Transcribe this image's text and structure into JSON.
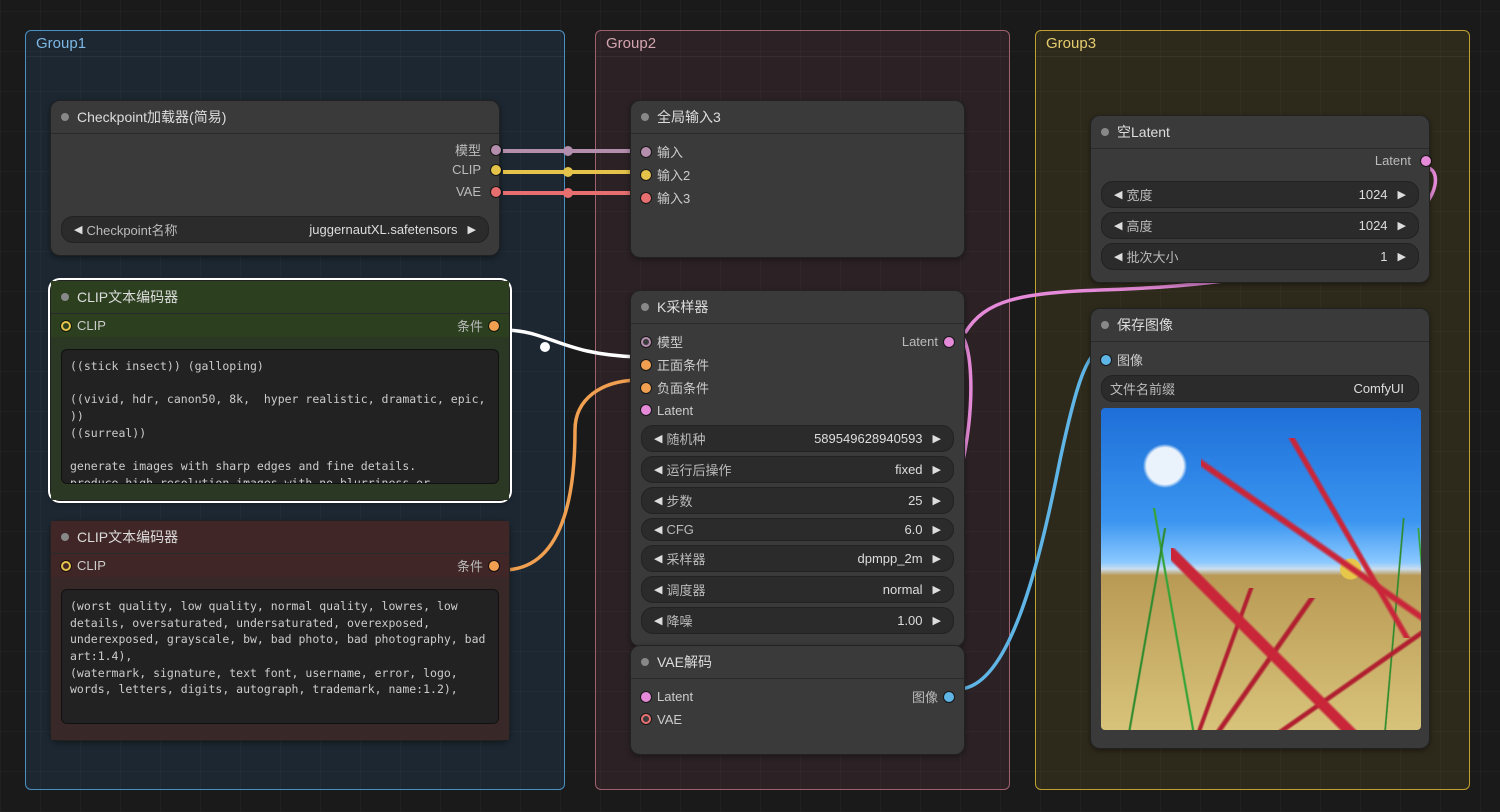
{
  "groups": {
    "g1": "Group1",
    "g2": "Group2",
    "g3": "Group3"
  },
  "checkpoint_loader": {
    "title": "Checkpoint加载器(简易)",
    "outputs": {
      "model": "模型",
      "clip": "CLIP",
      "vae": "VAE"
    },
    "widget_label": "Checkpoint名称",
    "widget_value": "juggernautXL.safetensors"
  },
  "clip_pos": {
    "title": "CLIP文本编码器",
    "input": "CLIP",
    "output": "条件",
    "text": "((stick insect)) (galloping)\n\n((vivid, hdr, canon50, 8k,  hyper realistic, dramatic, epic, ))\n((surreal))\n\ngenerate images with sharp edges and fine details.\nproduce high-resolution images with no blurriness or distortions.\ncreate images with clear and well-defined subjects.\nensure that the output images have crisp lines and distinct features."
  },
  "clip_neg": {
    "title": "CLIP文本编码器",
    "input": "CLIP",
    "output": "条件",
    "text": "(worst quality, low quality, normal quality, lowres, low details, oversaturated, undersaturated, overexposed, underexposed, grayscale, bw, bad photo, bad photography, bad art:1.4),\n(watermark, signature, text font, username, error, logo, words, letters, digits, autograph, trademark, name:1.2),"
  },
  "global_input": {
    "title": "全局输入3",
    "in1": "输入",
    "in2": "输入2",
    "in3": "输入3"
  },
  "ksampler": {
    "title": "K采样器",
    "in_model": "模型",
    "in_pos": "正面条件",
    "in_neg": "负面条件",
    "in_latent": "Latent",
    "out_latent": "Latent",
    "seed_label": "随机种",
    "seed_value": "589549628940593",
    "after_label": "运行后操作",
    "after_value": "fixed",
    "steps_label": "步数",
    "steps_value": "25",
    "cfg_label": "CFG",
    "cfg_value": "6.0",
    "sampler_label": "采样器",
    "sampler_value": "dpmpp_2m",
    "scheduler_label": "调度器",
    "scheduler_value": "normal",
    "denoise_label": "降噪",
    "denoise_value": "1.00"
  },
  "vae_decode": {
    "title": "VAE解码",
    "in_latent": "Latent",
    "in_vae": "VAE",
    "out_image": "图像"
  },
  "empty_latent": {
    "title": "空Latent",
    "out_latent": "Latent",
    "width_label": "宽度",
    "width_value": "1024",
    "height_label": "高度",
    "height_value": "1024",
    "batch_label": "批次大小",
    "batch_value": "1"
  },
  "save_image": {
    "title": "保存图像",
    "in_image": "图像",
    "prefix_label": "文件名前缀",
    "prefix_value": "ComfyUI"
  },
  "colors": {
    "model": "#b48ead",
    "clip": "#e5c24a",
    "vae": "#e76f6f",
    "cond": "#f0a050",
    "latent": "#e58ad8",
    "image": "#5fb5e5",
    "white": "#eeeeee"
  }
}
